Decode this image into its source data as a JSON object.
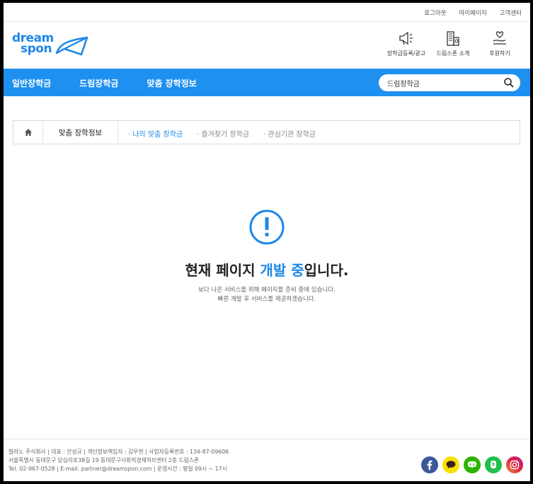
{
  "util_links": [
    "로그아웃",
    "마이페이지",
    "고객센터"
  ],
  "logo": {
    "line1": "dream",
    "line2": "spon"
  },
  "quick_menu": [
    {
      "label": "장학금등록/광고",
      "icon": "megaphone-icon"
    },
    {
      "label": "드림스폰 소개",
      "icon": "building-icon"
    },
    {
      "label": "후원하기",
      "icon": "heart-hand-icon"
    }
  ],
  "nav": [
    "일반장학금",
    "드림장학금",
    "맞춤 장학정보"
  ],
  "search": {
    "value": "드림장학금",
    "icon": "search-icon"
  },
  "breadcrumb": {
    "current": "맞춤 장학정보",
    "subs": [
      "· 나의 맞춤 장학금",
      "· 즐겨찾기 장학금",
      "· 관심기관 장학금"
    ]
  },
  "notice": {
    "title_pre": "현재 페이지 ",
    "title_hl": "개발 중",
    "title_post": "입니다.",
    "desc1": "보다 나은 서비스를 위해 페이지를 준비 중에 있습니다.",
    "desc2": "빠른 개발 후 서비스를 제공하겠습니다."
  },
  "footer": {
    "line1": "빌라노 주식회사  |  대표 : 안성규  |  개인정보책임자 : 김우현  |  사업자등록번호 : 134-87-09606",
    "line2": "서울특별시 동대문구 답십리로38길 19 동대문구사회적경제허브센터 2층 드림스폰",
    "line3": "Tel. 02-967-0528  |  E-mail. partner@dreamspon.com  |  운영시간 : 평일 09시 ~ 17시"
  },
  "social": [
    {
      "name": "facebook-icon",
      "color": "#3b5998"
    },
    {
      "name": "kakaotalk-icon",
      "color": "#fae100"
    },
    {
      "name": "blog-icon",
      "color": "#2db400"
    },
    {
      "name": "band-icon",
      "color": "#21c04a"
    },
    {
      "name": "instagram-icon",
      "color": "#d6249f"
    }
  ],
  "colors": {
    "accent": "#1e90f0",
    "text": "#333333"
  }
}
